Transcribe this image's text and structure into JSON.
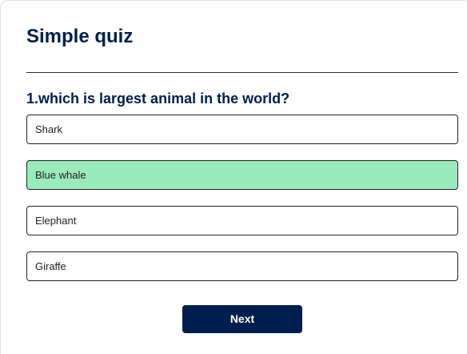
{
  "quiz": {
    "title": "Simple quiz",
    "question": "1.which is largest animal in the world?",
    "answers": [
      {
        "label": "Shark",
        "correct": false
      },
      {
        "label": "Blue whale",
        "correct": true
      },
      {
        "label": "Elephant",
        "correct": false
      },
      {
        "label": "Giraffe",
        "correct": false
      }
    ],
    "next_label": "Next"
  },
  "colors": {
    "primary": "#001e4d",
    "correct_bg": "#9aeabc",
    "border": "#222222"
  }
}
